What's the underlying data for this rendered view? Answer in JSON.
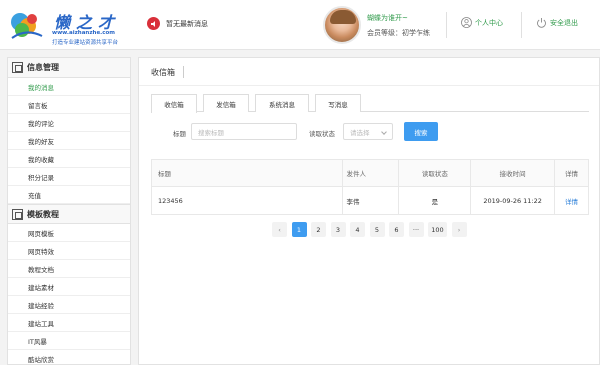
{
  "header": {
    "logo_title": "懒之才",
    "logo_url": "www.aizhanzhe.com",
    "logo_slogan": "打造专业建站资源共享平台",
    "notice_text": "暂无最新消息",
    "user_name": "蝴蝶为谁开~",
    "user_level": "会员等级：初学乍练",
    "user_center": "个人中心",
    "logout": "安全退出"
  },
  "sidebar": {
    "groups": [
      {
        "title": "信息管理",
        "items": [
          "我的消息",
          "留言板",
          "我的评论",
          "我的好友",
          "我的收藏",
          "积分记录",
          "充值"
        ]
      },
      {
        "title": "模板教程",
        "items": [
          "网页模板",
          "网页特效",
          "教程文档",
          "建站素材",
          "建站经验",
          "建站工具",
          "IT风暴",
          "酷站欣赏"
        ]
      }
    ]
  },
  "main": {
    "title": "收信箱",
    "tabs": [
      "收信箱",
      "发信箱",
      "系统消息",
      "写消息"
    ],
    "filter": {
      "title_label": "标题",
      "title_placeholder": "搜索标题",
      "status_label": "读取状态",
      "status_placeholder": "请选择",
      "search_button": "搜索"
    },
    "table": {
      "headers": [
        "标题",
        "发件人",
        "读取状态",
        "接收时间",
        "详情"
      ],
      "rows": [
        {
          "title": "123456",
          "sender": "李伟",
          "status": "是",
          "time": "2019-09-26 11:22",
          "detail": "详情"
        }
      ]
    },
    "pagination": {
      "prev": "‹",
      "pages": [
        "1",
        "2",
        "3",
        "4",
        "5",
        "6",
        "···",
        "100"
      ],
      "next": "›",
      "current": "1"
    }
  },
  "colors": {
    "accent_green": "#2f9a4a",
    "button_blue": "#3e9cf0",
    "logo_blue": "#2a67c7",
    "notice_red": "#d9303a"
  }
}
